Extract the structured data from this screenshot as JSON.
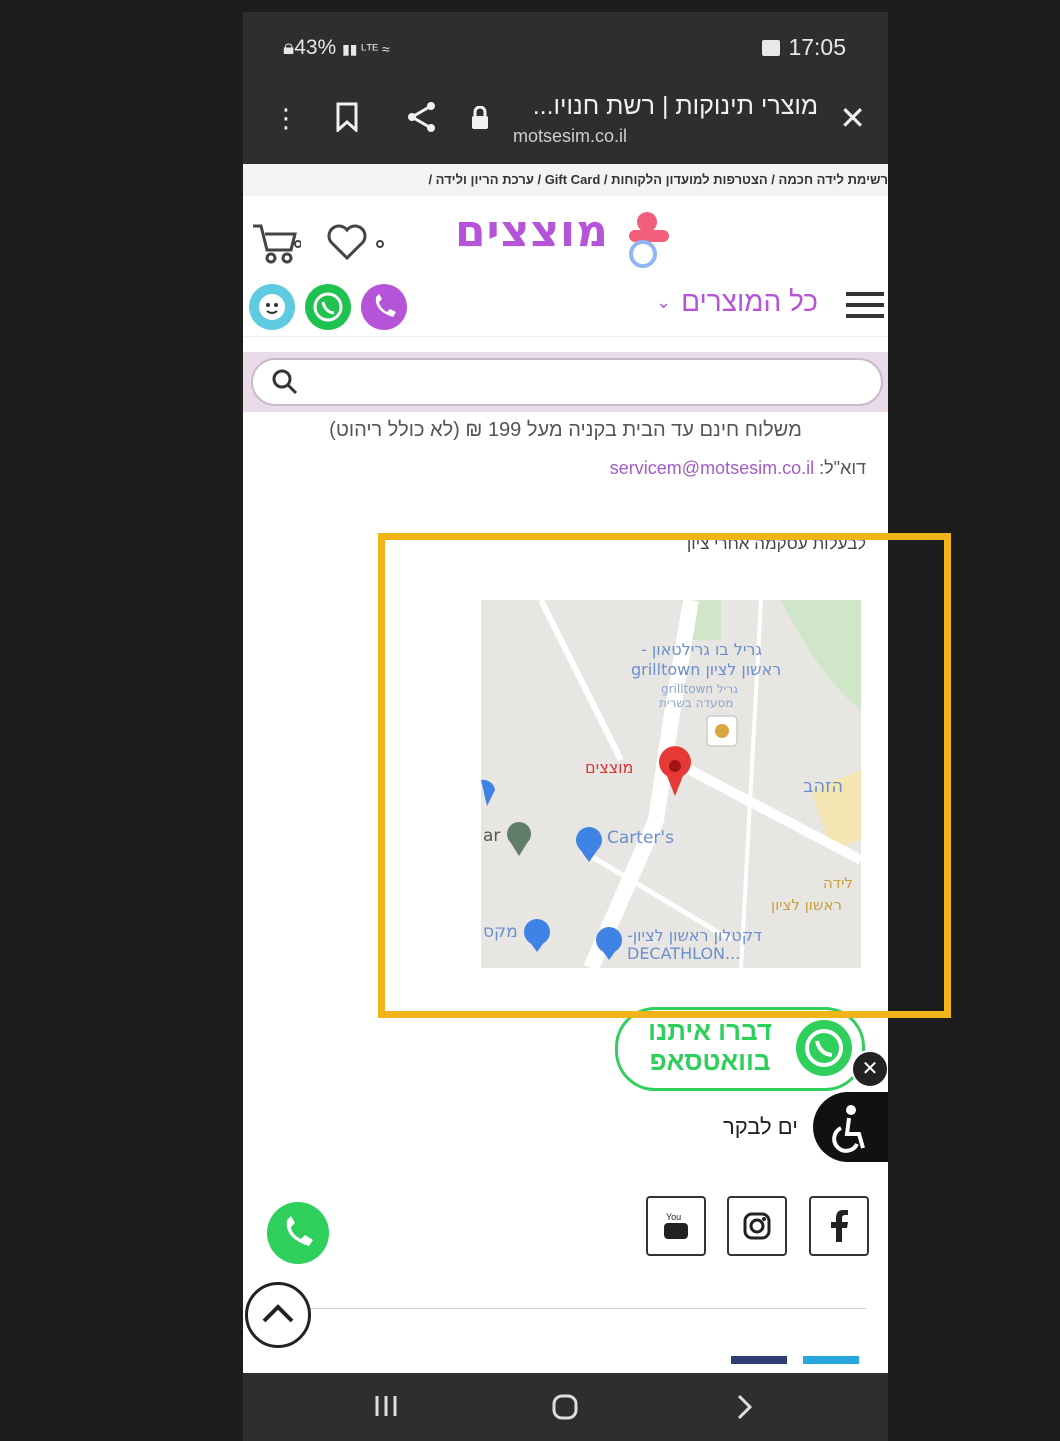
{
  "status_bar": {
    "battery": "43%",
    "time": "17:05"
  },
  "browser": {
    "tab_title": "מוצרי תינוקות | רשת חנויו...",
    "url": "motsesim.co.il"
  },
  "breadcrumb": "רשימת לידה חכמה / הצטרפות למועדון הלקוחות / Gift Card / ערכת הריון ולידה /",
  "header": {
    "logo_text": "מוצצים",
    "menu_label": "כל המוצרים"
  },
  "search": {
    "placeholder": ""
  },
  "info": {
    "shipping": "משלוח חינם עד הבית בקניה מעל 199 ₪ (לא כולל ריהוט)",
    "email_label": "דוא\"ל:",
    "email": "servicem@motsesim.co.il",
    "cutoff_text": "לבעלות עסקמה אחרי ציון"
  },
  "map": {
    "labels": {
      "grill": "גריל בו גרילטאון -",
      "grill2": "ראשון לציון grilltown",
      "grill3": "גריל grilltown",
      "grill4": "מסעדה בשרית",
      "store_pin": "מוצצים",
      "gold": "הזהב",
      "carters": "Carter's",
      "bar": "ar",
      "lida": "לידה",
      "rishon": "ראשון לציון",
      "max": "מקס",
      "decathlon1": "דקטלון ראשון לציון-",
      "decathlon2": "DECATHLON..."
    }
  },
  "whatsapp_cta": {
    "line1": "דברו איתנו",
    "line2": "בוואטסאפ"
  },
  "hours_text": "ים לבקר",
  "colors": {
    "brand": "#b554d9",
    "whatsapp": "#2fcf5c",
    "highlight": "#f0b418"
  }
}
